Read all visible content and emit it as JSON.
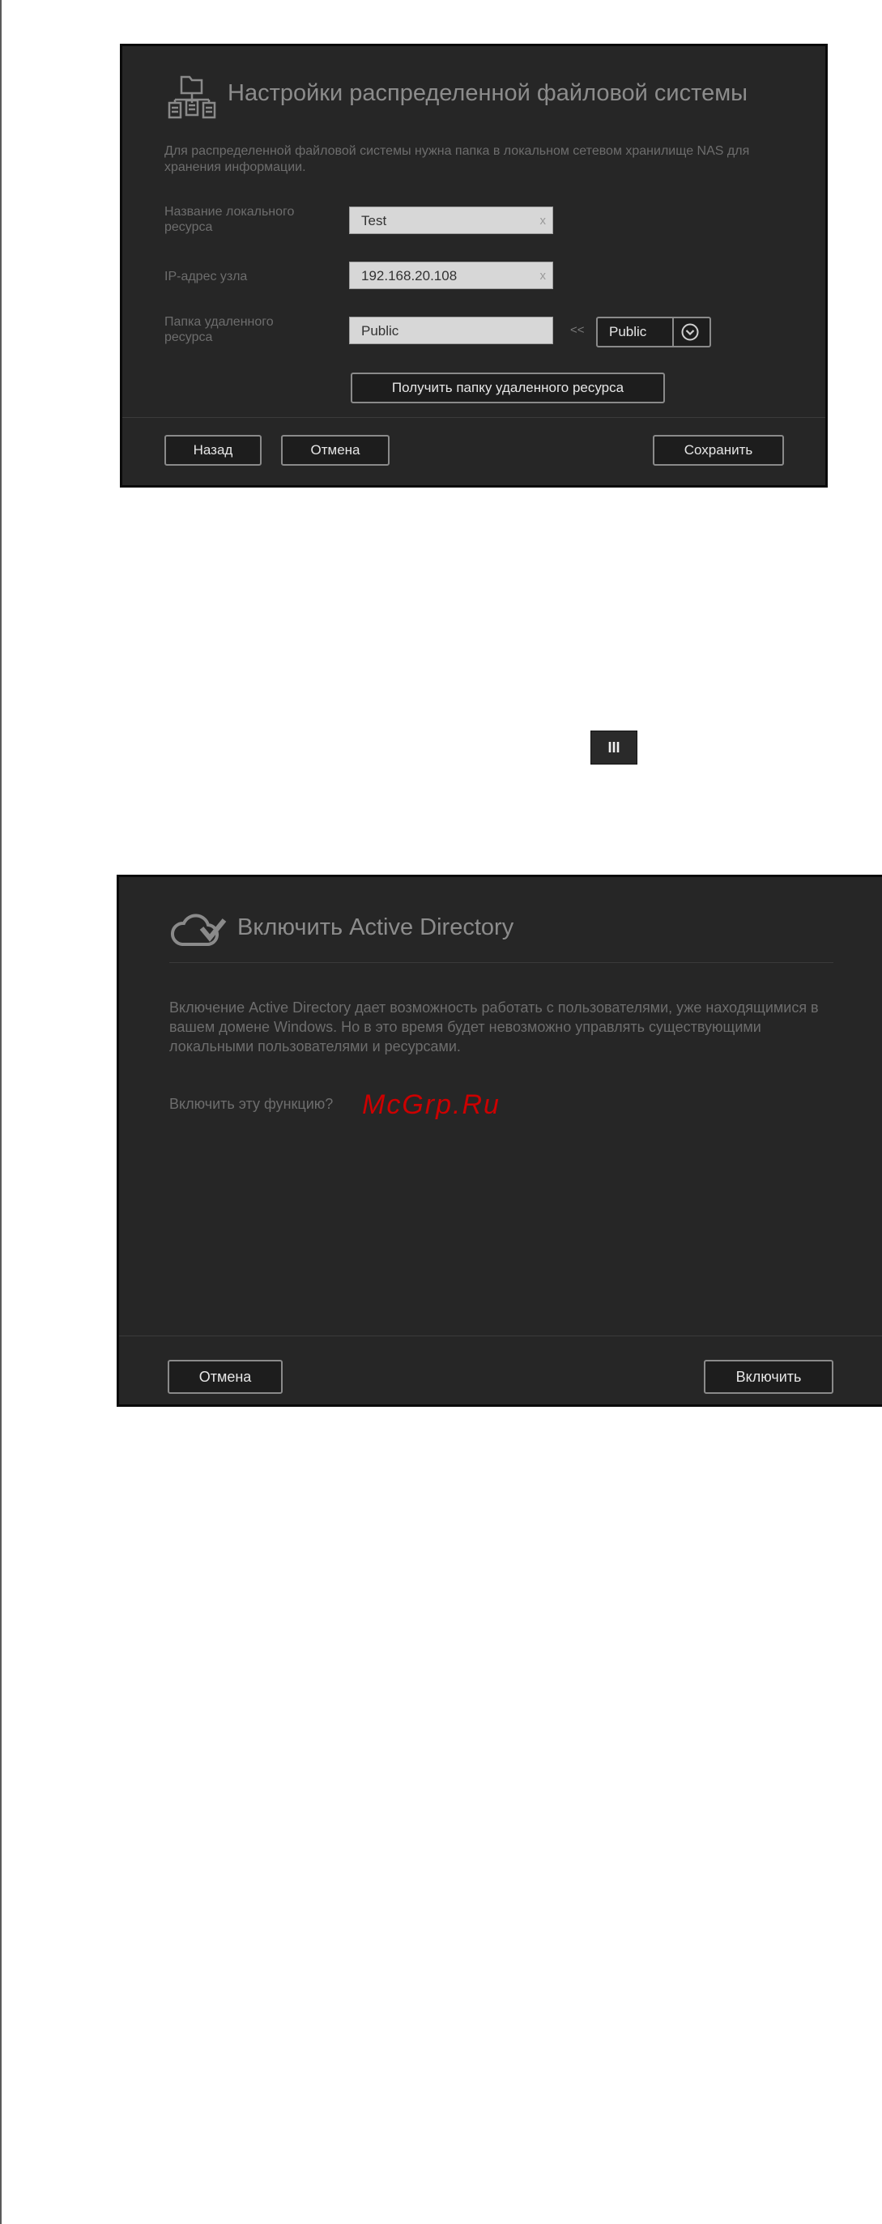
{
  "dfs_dialog": {
    "title": "Настройки распределенной файловой системы",
    "description": "Для распределенной файловой системы нужна папка в локальном сетевом хранилище NAS для хранения информации.",
    "fields": {
      "local_share_label": "Название локального ресурса",
      "local_share_value": "Test",
      "host_ip_label": "IP-адрес узла",
      "host_ip_value": "192.168.20.108",
      "remote_folder_label": "Папка удаленного ресурса",
      "remote_folder_value": "Public",
      "arrow_label": "<<",
      "remote_select_value": "Public"
    },
    "clear_symbol": "x",
    "get_remote_button": "Получить папку удаленного ресурса",
    "back_button": "Назад",
    "cancel_button": "Отмена",
    "save_button": "Сохранить"
  },
  "pause_button_label": "III",
  "ad_dialog": {
    "title": "Включить Active Directory",
    "description": "Включение Active Directory дает возможность работать с пользователями, уже находящимися в вашем домене Windows. Но в это время будет невозможно управлять существующими локальными пользователями и ресурсами.",
    "question": "Включить эту функцию?",
    "cancel_button": "Отмена",
    "enable_button": "Включить"
  },
  "watermark": "McGrp.Ru",
  "colors": {
    "dialog_bg": "#262626",
    "watermark": "#cc0000"
  }
}
